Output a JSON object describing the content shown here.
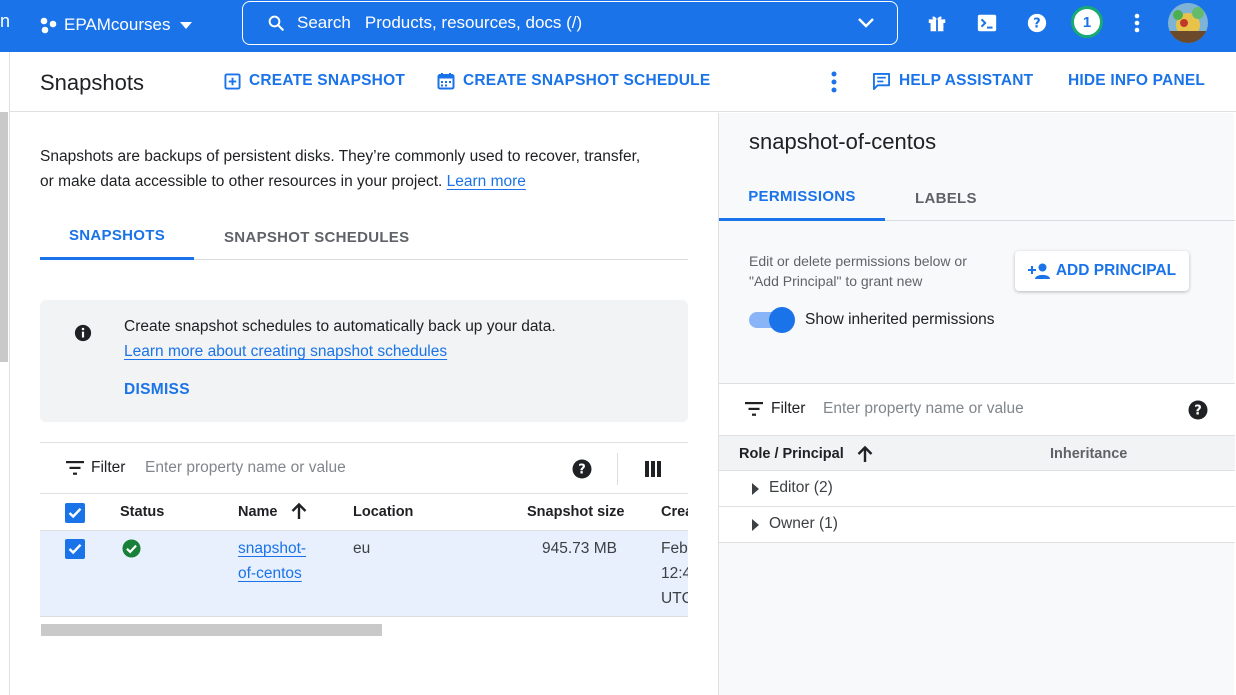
{
  "topbar": {
    "edge_text": "n",
    "project_name": "EPAMcourses",
    "search_label": "Search",
    "search_placeholder": "Products, resources, docs (/)",
    "notification_count": "1",
    "icons": [
      "gift-icon",
      "cloud-shell-icon",
      "help-icon",
      "more-vert-icon",
      "avatar"
    ]
  },
  "header": {
    "title": "Snapshots",
    "create_snapshot": "CREATE SNAPSHOT",
    "create_schedule": "CREATE SNAPSHOT SCHEDULE",
    "help_assistant": "HELP ASSISTANT",
    "hide_info_panel": "HIDE INFO PANEL"
  },
  "intro": {
    "text_line1": "Snapshots are backups of persistent disks. They’re commonly used to recover, transfer,",
    "text_line2": "or make data accessible to other resources in your project.",
    "learn_more": "Learn more"
  },
  "tabs": [
    {
      "label": "SNAPSHOTS",
      "active": true
    },
    {
      "label": "SNAPSHOT SCHEDULES",
      "active": false
    }
  ],
  "banner": {
    "message": "Create snapshot schedules to automatically back up your data.",
    "link": "Learn more about creating snapshot schedules",
    "dismiss": "DISMISS"
  },
  "filter": {
    "label": "Filter",
    "placeholder": "Enter property name or value"
  },
  "table": {
    "columns": [
      "Status",
      "Name",
      "Location",
      "Snapshot size",
      "Crea"
    ],
    "rows": [
      {
        "status": "ready",
        "name_line1": "snapshot-",
        "name_line2": "of-centos",
        "location": "eu",
        "size": "945.73 MB",
        "created_line1": "Feb",
        "created_line2": "12:4",
        "created_line3": "UTC"
      }
    ]
  },
  "info_panel": {
    "title": "snapshot-of-centos",
    "tabs": [
      {
        "label": "PERMISSIONS",
        "active": true
      },
      {
        "label": "LABELS",
        "active": false
      }
    ],
    "description_line1": "Edit or delete permissions below or",
    "description_line2": "\"Add Principal\" to grant new",
    "add_principal": "ADD PRINCIPAL",
    "toggle_label": "Show inherited permissions",
    "toggle_on": true,
    "filter_label": "Filter",
    "filter_placeholder": "Enter property name or value",
    "col_role": "Role / Principal",
    "col_inheritance": "Inheritance",
    "rows": [
      "Editor (2)",
      "Owner (1)"
    ]
  },
  "colors": {
    "brand_blue": "#1a73e8",
    "status_green": "#188038",
    "row_selected": "#e8f0fe",
    "banner_bg": "#f1f3f4"
  }
}
